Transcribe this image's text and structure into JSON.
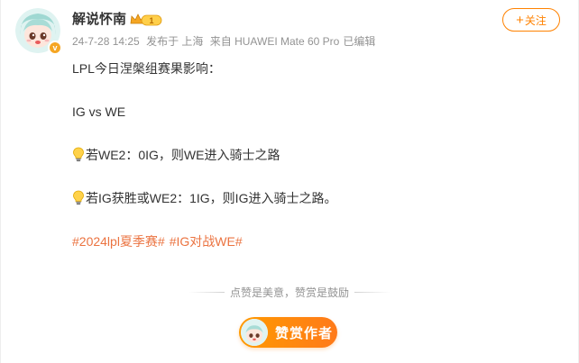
{
  "post": {
    "user": {
      "name": "解说怀南",
      "vip_level": "1",
      "avatar_icon": "anime-avatar-icon",
      "verified_badge": "v"
    },
    "follow_label": "关注",
    "meta": {
      "time": "24-7-28 14:25",
      "location": "发布于 上海",
      "source": "来自 HUAWEI Mate 60 Pro",
      "edited": "已编辑"
    },
    "content": {
      "line1": "LPL今日涅槃组赛果影响：",
      "line2": "IG vs WE",
      "line3": "若WE2：0IG，则WE进入骑士之路",
      "line4": "若IG获胜或WE2：1IG，则IG进入骑士之路。",
      "tags": [
        "#2024lpl夏季赛#",
        "#IG对战WE#"
      ],
      "bulb_icon": "light-bulb-icon"
    },
    "reward": {
      "divider_text": "点赞是美意，赞赏是鼓励",
      "button_label": "赞赏作者"
    },
    "colors": {
      "accent": "#ff8200",
      "tag": "#eb7340",
      "meta": "#939393"
    }
  }
}
